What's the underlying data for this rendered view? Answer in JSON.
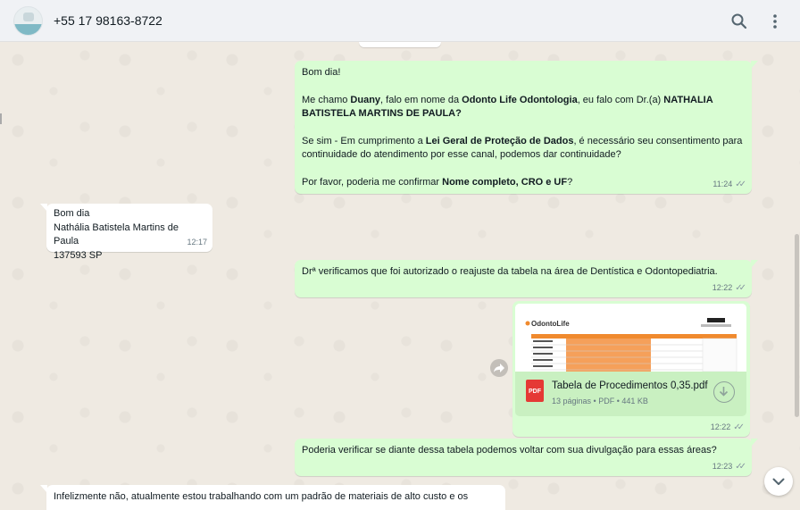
{
  "header": {
    "contact_name": "+55 17 98163-8722",
    "icons": [
      "avatar",
      "search-icon",
      "menu-icon"
    ]
  },
  "messages": {
    "m1": {
      "greeting": "Bom dia!",
      "l2a": "Me chamo ",
      "l2b": "Duany",
      "l2c": ", falo em nome da ",
      "l2d": "Odonto Life Odontologia",
      "l2e": ", eu falo com Dr.(a) ",
      "l2f": "NATHALIA BATISTELA MARTINS DE PAULA?",
      "l3a": "Se sim - Em cumprimento a ",
      "l3b": "Lei Geral de Proteção de Dados",
      "l3c": ", é necessário seu consentimento para continuidade do atendimento por esse canal, podemos dar continuidade?",
      "l4a": "Por favor, poderia me confirmar ",
      "l4b": "Nome completo, CRO e UF",
      "l4c": "?",
      "time": "11:24"
    },
    "m2": {
      "line1": "Bom dia",
      "line2": "Nathália Batistela Martins de Paula",
      "line3": "137593 SP",
      "time": "12:17"
    },
    "m3": {
      "text": "Drª verificamos que foi autorizado o reajuste da tabela na área de Dentística e Odontopediatria.",
      "time": "12:22"
    },
    "m4": {
      "pdf_label": "PDF",
      "file_name": "Tabela de Procedimentos 0,35.pdf",
      "file_meta": "13 páginas • PDF • 441 KB",
      "thumb_brand": "OdontoLife",
      "time": "12:22"
    },
    "m5": {
      "text": "Poderia verificar se diante dessa tabela podemos voltar com sua divulgação para essas áreas?",
      "time": "12:23"
    },
    "m6": {
      "text": "Infelizmente não, atualmente estou trabalhando com um padrão de materiais de alto custo e os"
    }
  },
  "colors": {
    "outgoing_bubble": "#d9fdd3",
    "incoming_bubble": "#ffffff",
    "chat_background": "#efeae2",
    "header_background": "#f0f2f5",
    "pdf_red": "#e53935",
    "thumb_orange": "#f5a05a"
  }
}
